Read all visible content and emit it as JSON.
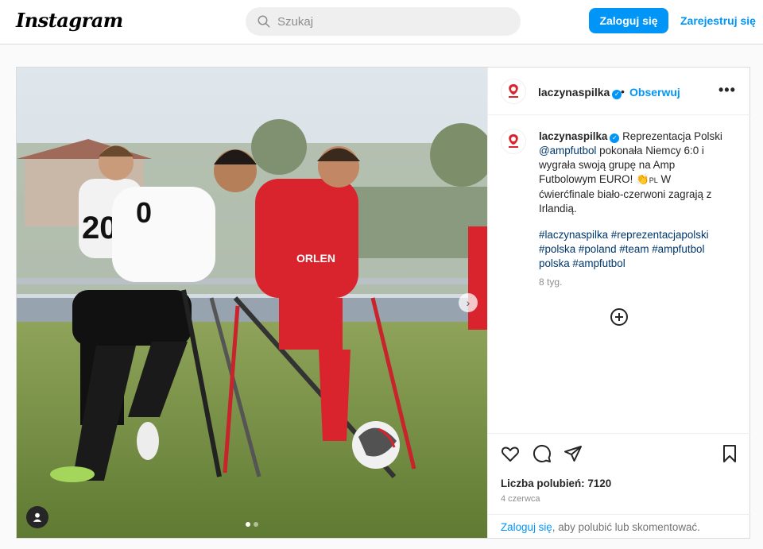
{
  "header": {
    "logo": "Instagram",
    "search_placeholder": "Szukaj",
    "login_label": "Zaloguj się",
    "signup_label": "Zarejestruj się"
  },
  "post": {
    "author": "laczynaspilka",
    "follow_label": "Obserwuj",
    "bullet": "•",
    "caption": {
      "author": "laczynaspilka",
      "text_1": "Reprezentacja Polski ",
      "mention": "@ampfutbol",
      "text_2": " pokonała Niemcy 6:0 i wygrała swoją grupę na Amp Futbolowym EURO! 👏",
      "flag": "PL",
      "text_3": " W ćwierćfinale biało-czerwoni zagrają z Irlandią."
    },
    "hashtags": "#laczynaspilka #reprezentacjapolski #polska #poland #team #ampfutbol​polska #ampfutbol",
    "time_ago": "8 tyg.",
    "likes": "Liczba polubień: 7120",
    "date": "4 czerwca",
    "login_prompt": {
      "link": "Zaloguj się",
      "text": ", aby polubić lub skomentować."
    },
    "carousel": {
      "current": 1,
      "total": 2
    }
  },
  "colors": {
    "accent": "#0095f6",
    "link": "#00376b",
    "muted": "#8e8e8e"
  }
}
